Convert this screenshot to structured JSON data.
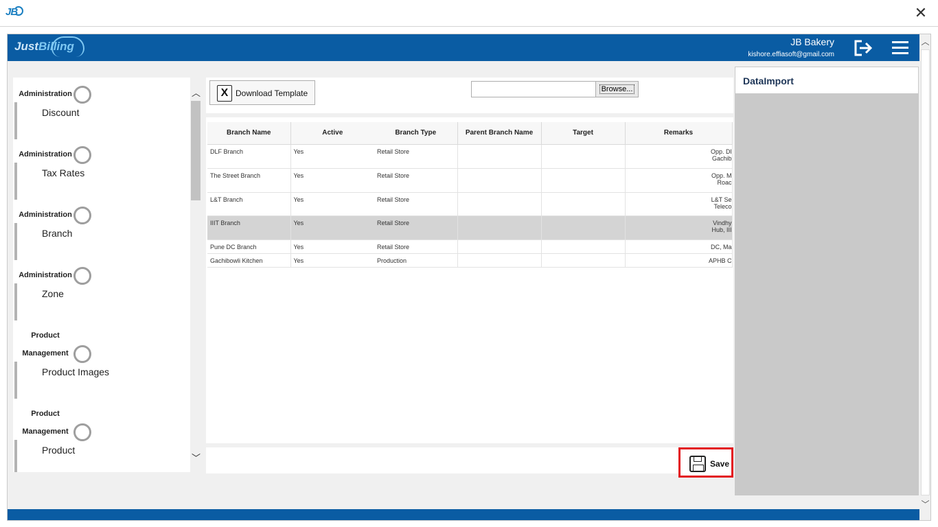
{
  "titlebar": {
    "logo_text": "JB",
    "close_glyph": "✕"
  },
  "header": {
    "brand_part1": "Just",
    "brand_part2": "Billing",
    "company": "JB Bakery",
    "email": "kishore.effiasoft@gmail.com"
  },
  "sidebar": {
    "items": [
      {
        "head": "Administration",
        "label": "Discount"
      },
      {
        "head": "Administration",
        "label": "Tax Rates"
      },
      {
        "head": "Administration",
        "label": "Branch"
      },
      {
        "head": "Administration",
        "label": "Zone"
      },
      {
        "head_line1": "Product",
        "head_line2": "Management",
        "label": "Product Images"
      },
      {
        "head_line1": "Product",
        "head_line2": "Management",
        "label": "Product"
      }
    ]
  },
  "toolbar": {
    "download_label": "Download Template",
    "file_value": "",
    "browse_label": "Browse..."
  },
  "grid": {
    "columns": [
      "Branch Name",
      "Active",
      "Branch Type",
      "Parent Branch Name",
      "Target",
      "Remarks"
    ],
    "rows": [
      {
        "name": "DLF Branch",
        "active": "Yes",
        "type": "Retail Store",
        "parent": "",
        "target": "",
        "remarks1": "Opp. Dl",
        "remarks2": "Gachib"
      },
      {
        "name": "The Street Branch",
        "active": "Yes",
        "type": "Retail Store",
        "parent": "",
        "target": "",
        "remarks1": "Opp. M",
        "remarks2": "Roac"
      },
      {
        "name": "L&T Branch",
        "active": "Yes",
        "type": "Retail Store",
        "parent": "",
        "target": "",
        "remarks1": "L&T Se",
        "remarks2": "Teleco"
      },
      {
        "name": "IIIT Branch",
        "active": "Yes",
        "type": "Retail Store",
        "parent": "",
        "target": "",
        "remarks1": "Vindhy",
        "remarks2": "Hub, III"
      },
      {
        "name": "Pune DC Branch",
        "active": "Yes",
        "type": "Retail Store",
        "parent": "",
        "target": "",
        "remarks1": "DC, Ma",
        "remarks2": ""
      },
      {
        "name": "Gachibowli Kitchen",
        "active": "Yes",
        "type": "Production",
        "parent": "",
        "target": "",
        "remarks1": "APHB C",
        "remarks2": ""
      }
    ]
  },
  "save": {
    "label": "Save"
  },
  "right_panel": {
    "title": "DataImport"
  },
  "icons": {
    "logout": "logout-icon",
    "menu": "hamburger-menu-icon",
    "excel": "excel-icon",
    "save": "floppy-save-icon",
    "close": "close-icon"
  },
  "colors": {
    "header": "#0a5ca3",
    "accent": "#7fc8f2",
    "highlight": "#e3141b"
  }
}
